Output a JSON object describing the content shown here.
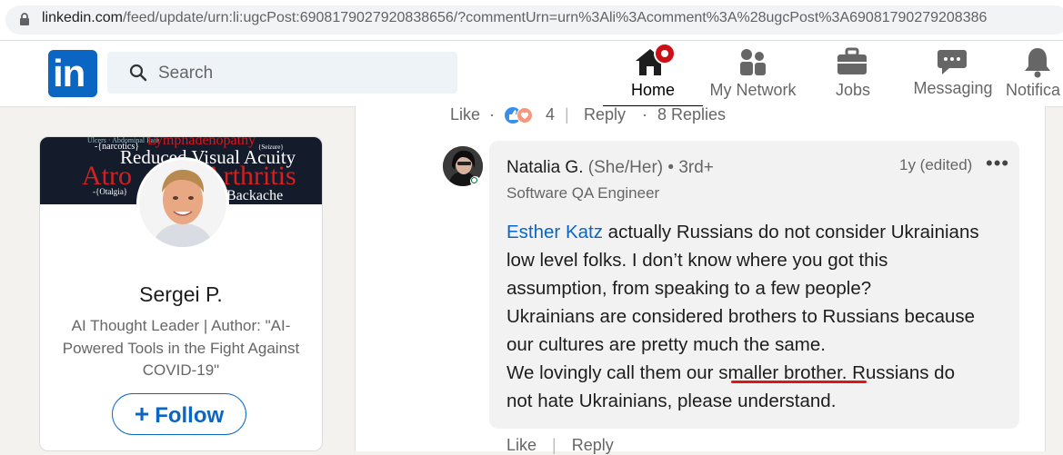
{
  "browser": {
    "url_host": "linkedin.com",
    "url_path": "/feed/update/urn:li:ugcPost:6908179027920838656/?commentUrn=urn%3Ali%3Acomment%3A%28ugcPost%3A69081790279208386"
  },
  "header": {
    "logo_text": "in",
    "search_placeholder": "Search",
    "nav": [
      {
        "label": "Home"
      },
      {
        "label": "My Network"
      },
      {
        "label": "Jobs"
      },
      {
        "label": "Messaging"
      },
      {
        "label": "Notifica"
      }
    ],
    "brand_color": "#0a66c2"
  },
  "profile": {
    "banner_words": [
      "Lymphadenopathy",
      "Reduced Visual Acuity",
      "Arthritis",
      "Atro",
      "Backache",
      "-{narcotics}",
      "-{Otalgia}"
    ],
    "name": "Sergei P.",
    "headline": "AI Thought Leader | Author: \"AI-Powered Tools in the Fight Against COVID-19\"",
    "follow_label": "Follow"
  },
  "post_actions": {
    "like": "Like",
    "separator": "·",
    "reaction_count": "4",
    "divider": "|",
    "reply": "Reply",
    "replies": "8 Replies"
  },
  "comment": {
    "author": "Natalia G.",
    "pronouns": "(She/Her)",
    "degree": "• 3rd+",
    "title": "Software QA Engineer",
    "time": "1y (edited)",
    "more": "•••",
    "mention": "Esther Katz",
    "line1_rest": " actually Russians do not consider Ukrainians",
    "line2": "low level folks. I don’t know where you got this",
    "line3": "assumption, from speaking to a few people?",
    "line4": "Ukrainians are considered brothers to Russians because",
    "line5": "our cultures are pretty much the same.",
    "line6_a": "We lovingly call them our ",
    "line6_b": "smaller brother",
    "line6_c": ". Russians do",
    "line7": "not hate Ukrainians, please understand.",
    "highlight_color": "#e0141b"
  },
  "comment_actions": {
    "like": "Like",
    "separator": "|",
    "reply": "Reply"
  }
}
